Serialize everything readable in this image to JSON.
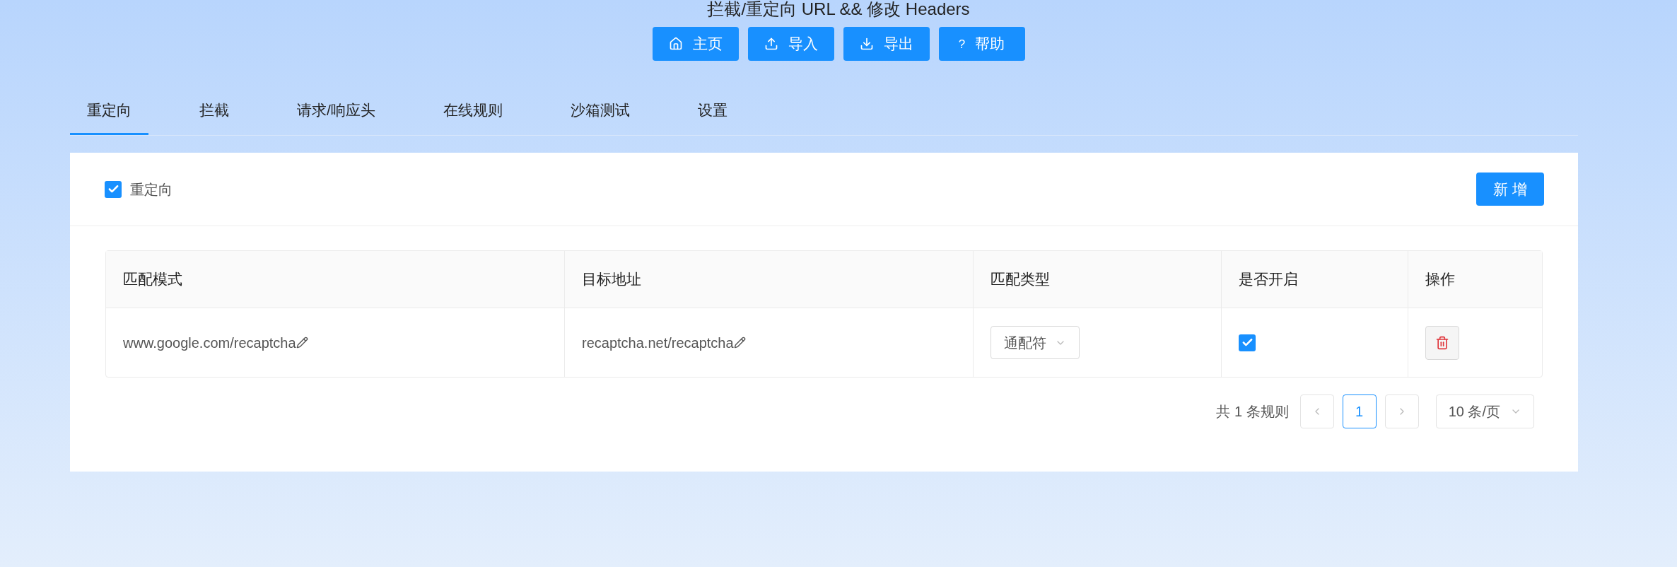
{
  "header": {
    "title": "拦截/重定向 URL && 修改 Headers",
    "buttons": [
      {
        "kind": "home",
        "label": "主页"
      },
      {
        "kind": "upload",
        "label": "导入"
      },
      {
        "kind": "download",
        "label": "导出"
      },
      {
        "kind": "help",
        "glyph": "?",
        "label": "帮助"
      }
    ]
  },
  "tabs": [
    {
      "label": "重定向",
      "selected": true
    },
    {
      "label": "拦截",
      "selected": false
    },
    {
      "label": "请求/响应头",
      "selected": false
    },
    {
      "label": "在线规则",
      "selected": false
    },
    {
      "label": "沙箱测试",
      "selected": false
    },
    {
      "label": "设置",
      "selected": false
    }
  ],
  "panel": {
    "toggle": {
      "label": "重定向",
      "checked": true
    },
    "add_button": "新 增",
    "table": {
      "columns": [
        "匹配模式",
        "目标地址",
        "匹配类型",
        "是否开启",
        "操作"
      ],
      "rows": [
        {
          "pattern": "www.google.com/recaptcha",
          "target": "recaptcha.net/recaptcha",
          "match_type": "通配符",
          "enabled": true
        }
      ]
    },
    "pagination": {
      "total": "共 1 条规则",
      "pages": [
        {
          "label": "1",
          "selected": true
        }
      ],
      "page_size": "10 条/页"
    }
  }
}
